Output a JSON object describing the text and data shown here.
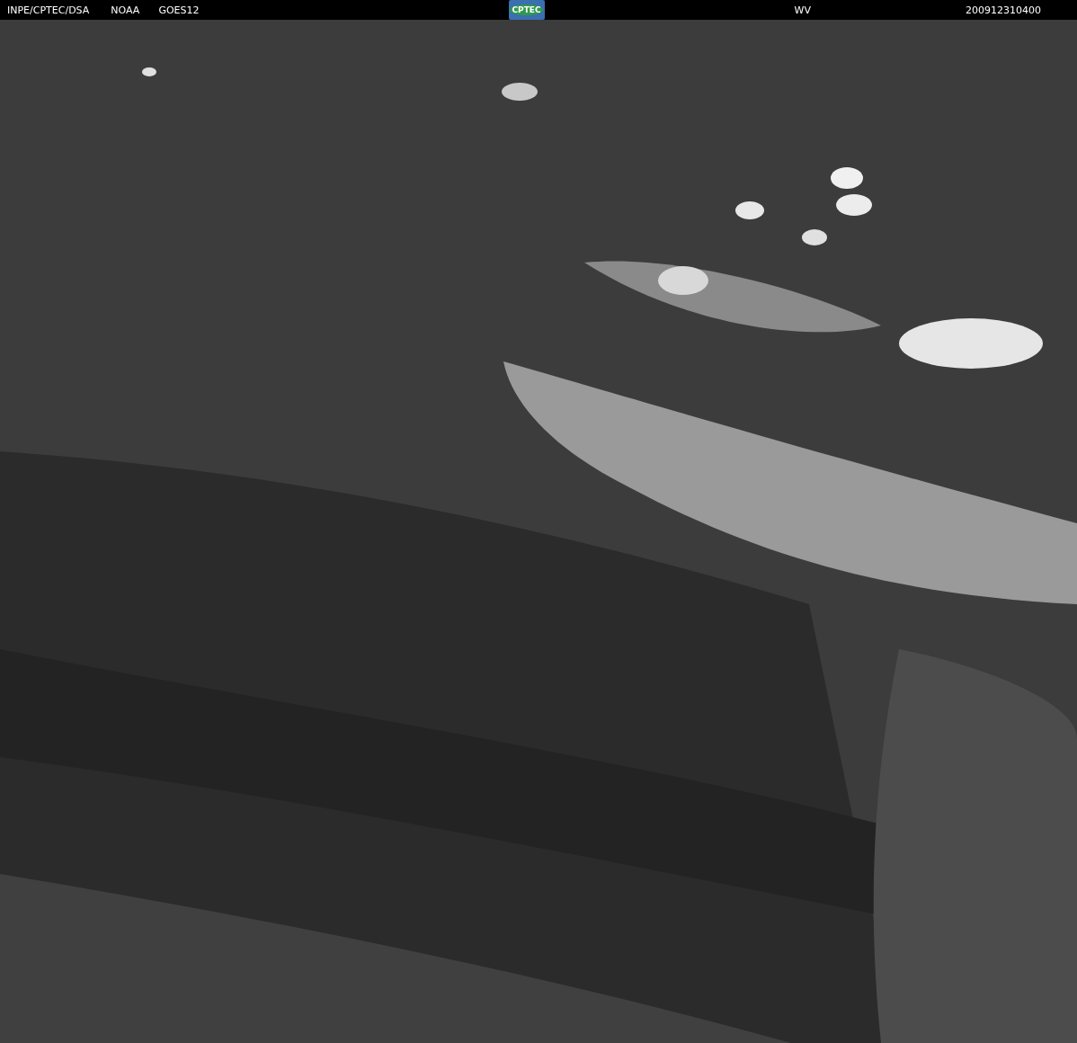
{
  "header": {
    "labels": [
      "INPE/CPTEC/DSA",
      "NOAA",
      "GOES12"
    ],
    "logo": "CPTEC",
    "channel": "WV",
    "timestamp": "200912310400"
  }
}
